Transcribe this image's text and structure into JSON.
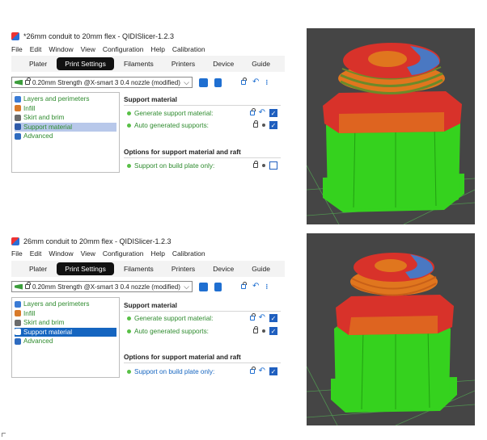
{
  "panels": [
    {
      "title": "*26mm conduit to 20mm flex - QIDISlicer-1.2.3",
      "menu": [
        "File",
        "Edit",
        "Window",
        "View",
        "Configuration",
        "Help",
        "Calibration"
      ],
      "tabs": [
        "Plater",
        "Print Settings",
        "Filaments",
        "Printers",
        "Device",
        "Guide"
      ],
      "active_tab": "Print Settings",
      "preset": "0.20mm Strength @X-smart 3 0.4 nozzle (modified)",
      "tree": [
        "Layers and perimeters",
        "Infill",
        "Skirt and brim",
        "Support material",
        "Advanced"
      ],
      "selected_tree": "Support material",
      "group1_title": "Support material",
      "opt_generate": "Generate support material:",
      "opt_auto": "Auto generated supports:",
      "group2_title": "Options for support material and raft",
      "opt_buildplate": "Support on build plate only:",
      "states": {
        "generate": true,
        "auto": true,
        "buildplate": false
      }
    },
    {
      "title": "26mm conduit to 20mm flex - QIDISlicer-1.2.3",
      "menu": [
        "File",
        "Edit",
        "Window",
        "View",
        "Configuration",
        "Help",
        "Calibration"
      ],
      "tabs": [
        "Plater",
        "Print Settings",
        "Filaments",
        "Printers",
        "Device",
        "Guide"
      ],
      "active_tab": "Print Settings",
      "preset": "0.20mm Strength @X-smart 3 0.4 nozzle (modified)",
      "tree": [
        "Layers and perimeters",
        "Infill",
        "Skirt and brim",
        "Support material",
        "Advanced"
      ],
      "selected_tree": "Support material",
      "group1_title": "Support material",
      "opt_generate": "Generate support material:",
      "opt_auto": "Auto generated supports:",
      "group2_title": "Options for support material and raft",
      "opt_buildplate": "Support on build plate only:",
      "states": {
        "generate": true,
        "auto": true,
        "buildplate": true
      }
    }
  ],
  "icons": {
    "lock": "lock-icon",
    "undo": "undo-arrow-icon",
    "save": "save-icon",
    "compare": "compare-icon",
    "flag": "green-flag-icon"
  },
  "colors": {
    "accent": "#1f5fbf",
    "green_text": "#2e8b2e",
    "model_green": "#35d21e",
    "model_orange": "#e0761e",
    "model_red": "#d8322a",
    "model_blue": "#4a78c2",
    "viewport_bg": "#454545"
  }
}
